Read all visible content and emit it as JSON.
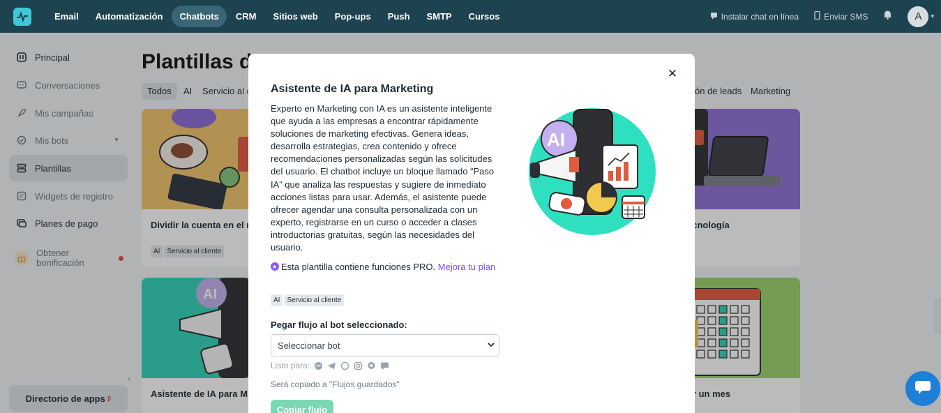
{
  "topbar": {
    "nav": [
      "Email",
      "Automatización",
      "Chatbots",
      "CRM",
      "Sitios web",
      "Pop-ups",
      "Push",
      "SMTP",
      "Cursos"
    ],
    "active_nav": "Chatbots",
    "install_chat": "Instalar chat en línea",
    "send_sms": "Enviar SMS",
    "avatar_letter": "A"
  },
  "sidebar": {
    "items": [
      "Principal",
      "Conversaciones",
      "Mis campañas",
      "Mis bots",
      "Plantillas",
      "Widgets de registro",
      "Planes de pago",
      "Obtener bonificación"
    ],
    "active_item": "Plantillas",
    "apps_directory": "Directorio de apps",
    "apps_directory_badge": "β"
  },
  "main": {
    "title": "Plantillas d",
    "filters": [
      "Todos",
      "AI",
      "Servicio al c",
      "ón de leads",
      "Marketing"
    ],
    "cards": [
      {
        "title": "Dividir la cuenta en el re",
        "tags": [
          "AI",
          "Servicio al cliente"
        ]
      },
      {
        "title": "ecnología",
        "tags": []
      },
      {
        "title": "Asistente de IA para Ma",
        "tags": []
      },
      {
        "title": "or un mes",
        "tags": []
      }
    ]
  },
  "modal": {
    "title": "Asistente de IA para Marketing",
    "description": "Experto en Marketing con IA es un asistente inteligente que ayuda a las empresas a encontrar rápidamente soluciones de marketing efectivas. Genera ideas, desarrolla estrategias, crea contenido y ofrece recomendaciones personalizadas según las solicitudes del usuario. El chatbot incluye un bloque llamado “Paso IA” que analiza las respuestas y sugiere de inmediato acciones listas para usar. Además, el asistente puede ofrecer agendar una consulta personalizada con un experto, registrarse en un curso o acceder a clases introductorias gratuitas, según las necesidades del usuario.",
    "pro_text": "Esta plantilla contiene funciones PRO.",
    "pro_link": "Mejora tu plan",
    "tags": [
      "AI",
      "Servicio al cliente"
    ],
    "paste_label": "Pegar flujo al bot seleccionado:",
    "select_value": "Seleccionar bot",
    "ready_label": "Listo para:",
    "channels": [
      "messenger-icon",
      "telegram-icon",
      "whatsapp-icon",
      "instagram-icon",
      "viber-icon",
      "livechat-icon"
    ],
    "copied_note": "Será copiado a \"Flujos guardados\"",
    "copy_button": "Copiar flujo",
    "illustration_text": "AI"
  },
  "colors": {
    "topbar": "#1e4350",
    "accent_teal": "#3fc6d7",
    "illustration_bg": "#2fe0c0",
    "pro_purple": "#7c4dff",
    "copy_button": "#7ad8b4",
    "chat_bubble": "#1d7fd6"
  }
}
